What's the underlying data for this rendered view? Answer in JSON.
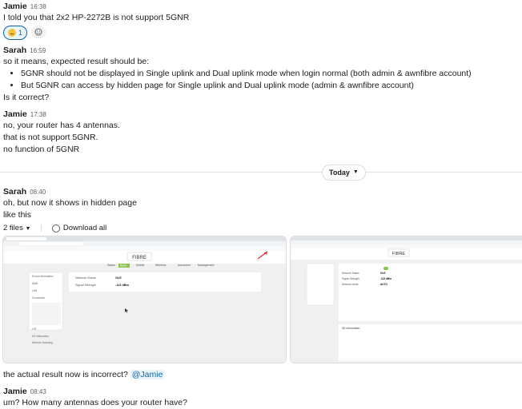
{
  "messages": {
    "m1": {
      "name": "Jamie",
      "time": "16:38",
      "text": "I told you that 2x2 HP-2272B is not support 5GNR",
      "reaction": {
        "count": "1"
      }
    },
    "m2": {
      "name": "Sarah",
      "time": "16:59",
      "intro": "so it means, expected result should be:",
      "bullets": [
        "5GNR should not be displayed in Single uplink and Dual uplink mode when login normal (both admin & awnfibre account)",
        "But 5GNR can access by hidden page for Single uplink and Dual uplink mode (admin & awnfibre account)"
      ],
      "outro": "Is it correct?"
    },
    "m3": {
      "name": "Jamie",
      "time": "17:38",
      "lines": [
        "no, your router has 4 antennas.",
        "that is not support 5GNR.",
        "no function of 5GNR"
      ]
    },
    "divider": {
      "label": "Today"
    },
    "m4": {
      "name": "Sarah",
      "time": "08:40",
      "lines": [
        "oh, but now it shows in hidden page",
        "like this"
      ],
      "files_label": "2 files",
      "download_label": "Download all"
    },
    "m5": {
      "text": "the actual result now is incorrect?",
      "mention": "@Jamie"
    },
    "m6": {
      "name": "Jamie",
      "time": "08:43",
      "text": "um? How many antennas does your router have?"
    }
  },
  "screenshot1": {
    "brand": "FIBRE",
    "tabs": [
      "Status",
      "Basic",
      "Mobile",
      "Wireless",
      "Advanced",
      "Management"
    ],
    "fields": [
      {
        "label": "Network Status",
        "value": "OLE"
      },
      {
        "label": "Signal Strength",
        "value": "-113 dBm"
      }
    ],
    "sidebar": [
      "Device Information",
      "WAN",
      "LAN",
      "Connection",
      "LTE",
      "5G Information",
      "Network Scanning"
    ]
  },
  "screenshot2": {
    "brand": "FIBRE",
    "fields": [
      {
        "label": "Network Status",
        "value": "OLE"
      },
      {
        "label": "Signal Strength",
        "value": "-113 dBm"
      },
      {
        "label": "Network mode",
        "value": "AUTO"
      }
    ],
    "section_title": "5G Information"
  },
  "colors": {
    "accent": "#1264a3",
    "arrow": "#d9342b",
    "brand_green": "#8bc34a"
  }
}
